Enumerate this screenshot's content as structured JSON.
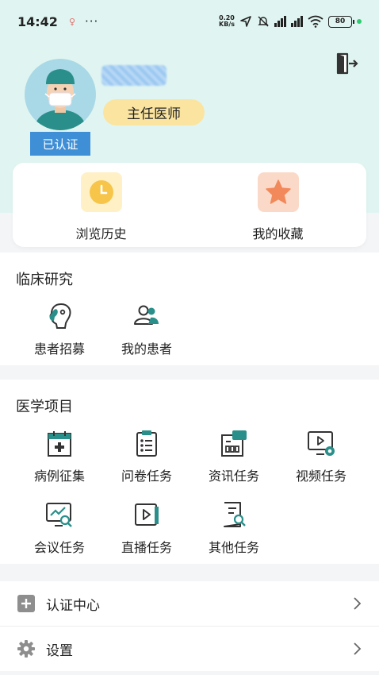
{
  "status_bar": {
    "time": "14:42",
    "speed_value": "0.20",
    "speed_unit": "KB/s",
    "battery": "80"
  },
  "profile": {
    "verified_label": "已认证",
    "title_label": "主任医师"
  },
  "quick_actions": [
    {
      "label": "浏览历史",
      "icon": "clock-icon"
    },
    {
      "label": "我的收藏",
      "icon": "star-icon"
    }
  ],
  "clinical": {
    "title": "临床研究",
    "items": [
      {
        "label": "患者招募",
        "icon": "recruit-icon"
      },
      {
        "label": "我的患者",
        "icon": "patients-icon"
      }
    ]
  },
  "medical": {
    "title": "医学项目",
    "items": [
      {
        "label": "病例征集",
        "icon": "case-collect-icon"
      },
      {
        "label": "问卷任务",
        "icon": "questionnaire-icon"
      },
      {
        "label": "资讯任务",
        "icon": "news-task-icon"
      },
      {
        "label": "视频任务",
        "icon": "video-task-icon"
      },
      {
        "label": "会议任务",
        "icon": "meeting-task-icon"
      },
      {
        "label": "直播任务",
        "icon": "live-task-icon"
      },
      {
        "label": "其他任务",
        "icon": "other-task-icon"
      }
    ]
  },
  "menu": [
    {
      "label": "认证中心",
      "icon": "plus-square-icon"
    },
    {
      "label": "设置",
      "icon": "gear-icon"
    }
  ],
  "colors": {
    "header_bg": "#e0f5f1",
    "accent_teal": "#2a8f8a",
    "verified_blue": "#3f8fd6",
    "title_badge": "#fbe4a0"
  }
}
